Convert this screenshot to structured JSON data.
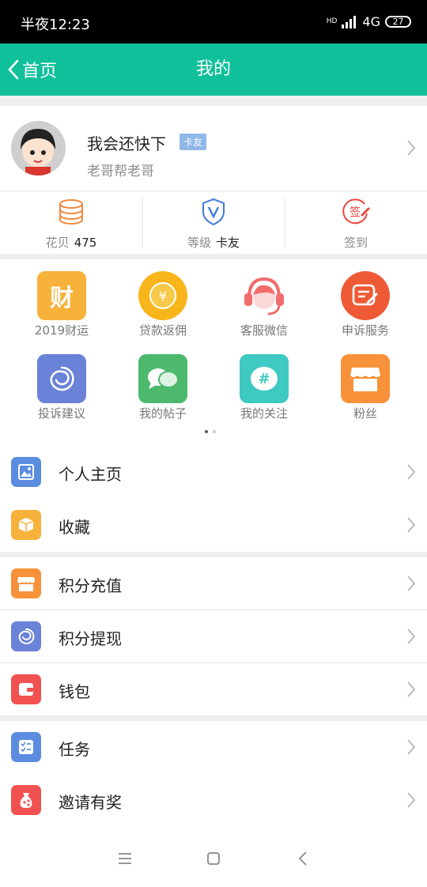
{
  "status_bar": {
    "time": "半夜12:23",
    "network": "4G",
    "hd": "HD",
    "battery": "27"
  },
  "nav": {
    "back_label": "首页",
    "title": "我的"
  },
  "profile": {
    "username": "我会还快下",
    "badge": "卡友",
    "subtitle": "老哥帮老哥"
  },
  "stats": [
    {
      "label": "花贝",
      "value": "475",
      "icon": "coins-icon",
      "color": "#f0883a"
    },
    {
      "label": "等级",
      "value": "卡友",
      "icon": "shield-v-icon",
      "color": "#3d7ad6"
    },
    {
      "label": "签到",
      "value": "",
      "icon": "sign-in-icon",
      "color": "#e9463a"
    }
  ],
  "grid": [
    {
      "label": "2019财运",
      "icon": "fortune-icon",
      "glyph": "财",
      "color": "#f7b23b"
    },
    {
      "label": "贷款返佣",
      "icon": "yuan-coin-icon",
      "glyph": "¥",
      "color": "#f8b51c"
    },
    {
      "label": "客服微信",
      "icon": "customer-service-icon",
      "glyph": "",
      "color": "#f26c6c"
    },
    {
      "label": "申诉服务",
      "icon": "appeal-icon",
      "glyph": "",
      "color": "#ef5a36"
    },
    {
      "label": "投诉建议",
      "icon": "spiral-icon",
      "glyph": "",
      "color": "#6a82d8"
    },
    {
      "label": "我的帖子",
      "icon": "chat-bubbles-icon",
      "glyph": "",
      "color": "#4cb96d"
    },
    {
      "label": "我的关注",
      "icon": "hashtag-icon",
      "glyph": "#",
      "color": "#3ec9c1"
    },
    {
      "label": "粉丝",
      "icon": "shop-icon",
      "glyph": "",
      "color": "#f7923a"
    }
  ],
  "list": [
    {
      "label": "个人主页",
      "icon": "image-icon",
      "color": "#5b8ce0"
    },
    {
      "label": "收藏",
      "icon": "box-icon",
      "color": "#f7b23b"
    },
    {
      "label": "积分充值",
      "icon": "shop-icon",
      "color": "#f7923a"
    },
    {
      "label": "积分提现",
      "icon": "spiral-icon",
      "color": "#6a82d8"
    },
    {
      "label": "钱包",
      "icon": "wallet-icon",
      "color": "#f25151"
    },
    {
      "label": "任务",
      "icon": "checklist-icon",
      "color": "#5b8ce0"
    },
    {
      "label": "邀请有奖",
      "icon": "gift-bag-icon",
      "color": "#f25151"
    }
  ]
}
